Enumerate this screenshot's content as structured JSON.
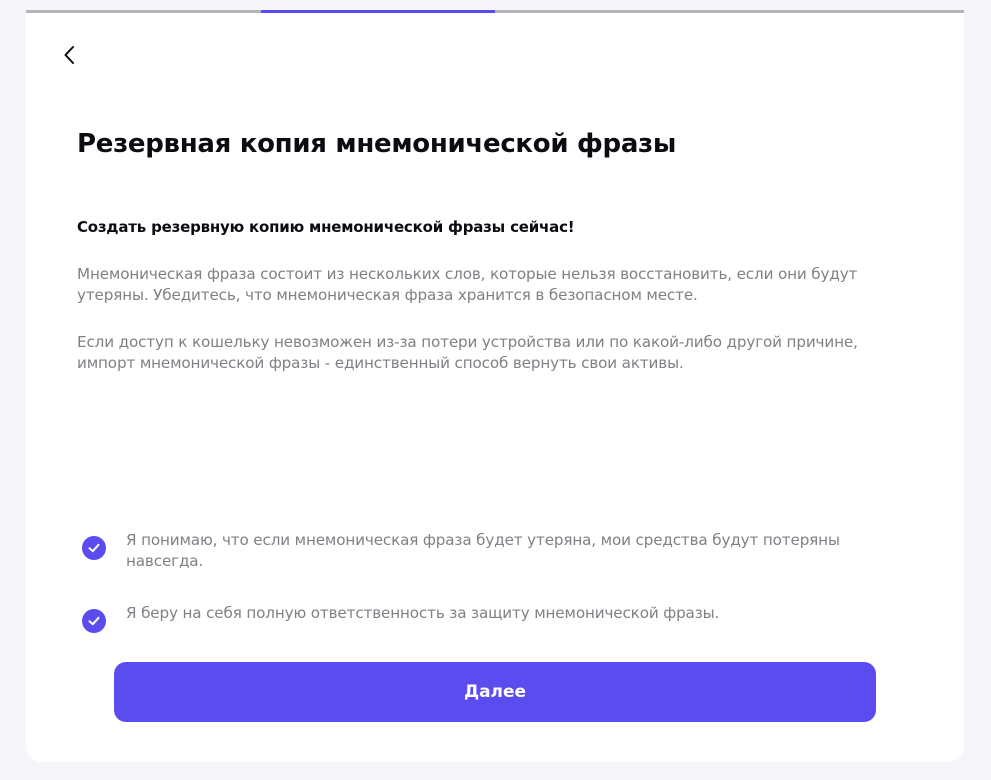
{
  "progress": {
    "steps": 4,
    "active_step": 2,
    "track_color": "#b4b4b9",
    "fill_color": "#5b4cf0"
  },
  "header": {
    "back_icon": "chevron-left-icon"
  },
  "main": {
    "title": "Резервная копия мнемонической фразы",
    "subtitle": "Создать резервную копию мнемонической фразы сейчас!",
    "paragraphs": [
      "Мнемоническая фраза состоит из нескольких слов, которые нельзя восстановить, если они будут утеряны. Убедитесь, что мнемоническая фраза хранится в безопасном месте.",
      "Если доступ к кошельку невозможен из-за потери устройства или по какой-либо другой причине, импорт мнемонической фразы - единственный способ вернуть свои активы."
    ]
  },
  "agreements": [
    {
      "checked": true,
      "label": "Я понимаю, что если мнемоническая фраза будет утеряна, мои средства будут потеряны навсегда."
    },
    {
      "checked": true,
      "label": "Я беру на себя полную ответственность за защиту мнемонической фразы."
    }
  ],
  "actions": {
    "next_label": "Далее"
  },
  "colors": {
    "accent": "#5b4cf0",
    "background": "#f6f6fa",
    "text_primary": "#0b0b12",
    "text_secondary": "#808086"
  }
}
